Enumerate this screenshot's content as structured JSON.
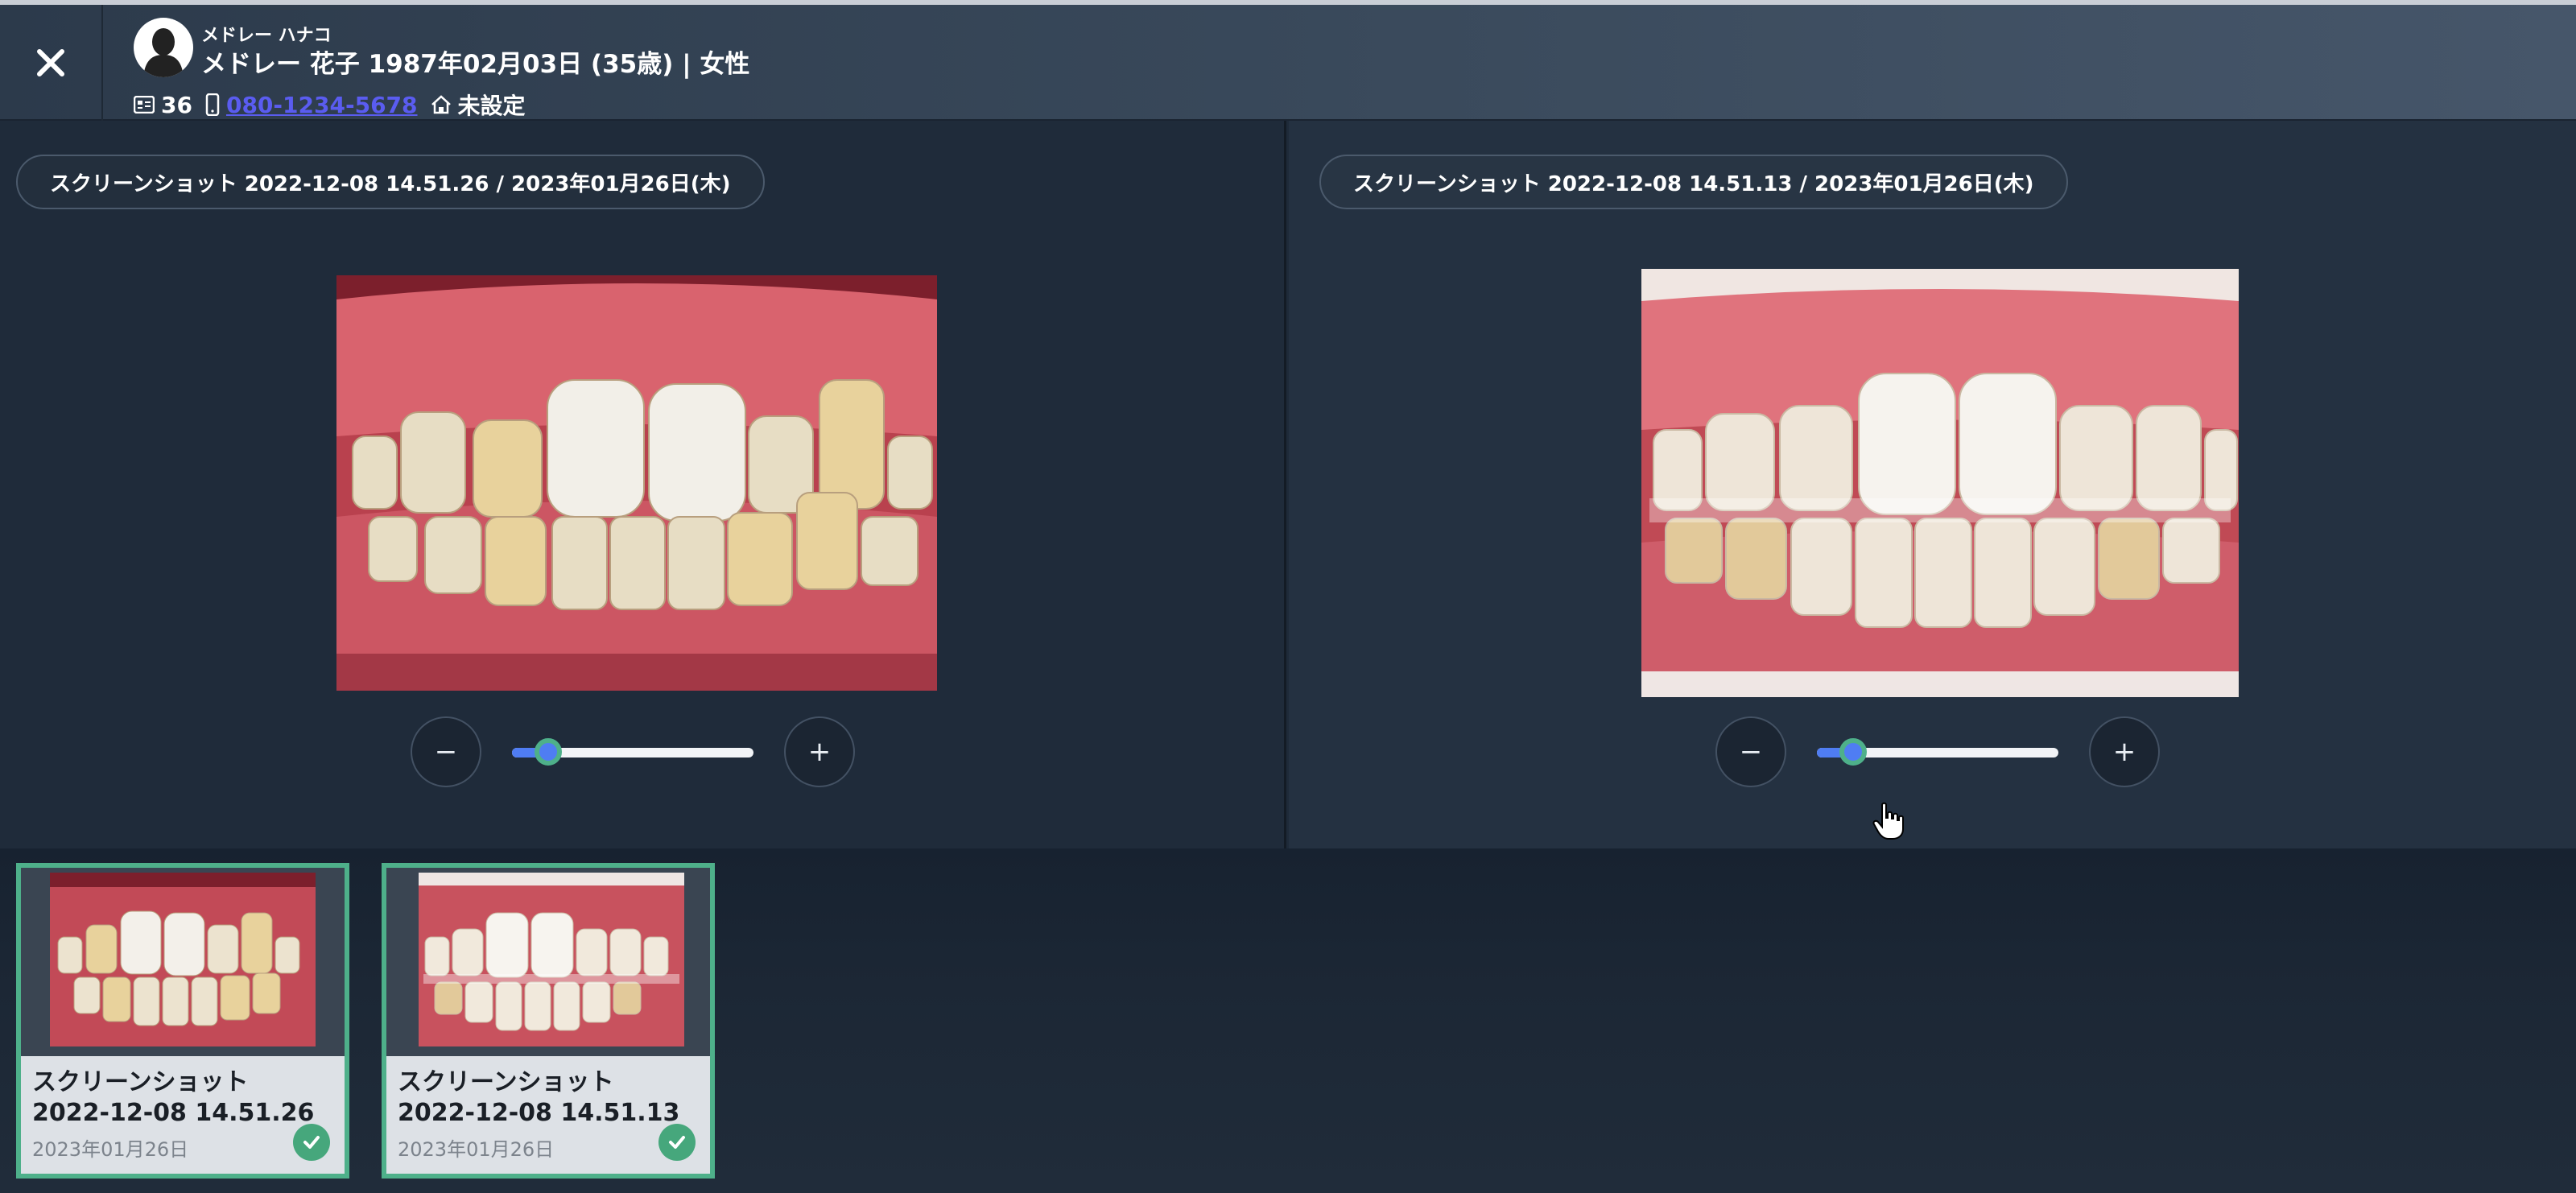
{
  "header": {
    "close_icon": "close-icon",
    "kana_name": "メドレー ハナコ",
    "name_line": "メドレー 花子 1987年02月03日 (35歳) | 女性",
    "patient_id": "36",
    "phone": "080-1234-5678",
    "address": "未設定",
    "phone_color": "#5a5cf0"
  },
  "panels": [
    {
      "title": "スクリーンショット 2022-12-08 14.51.26 / 2023年01月26日(木)",
      "zoom_minus": "−",
      "zoom_plus": "+",
      "zoom_level": 0.15
    },
    {
      "title": "スクリーンショット 2022-12-08 14.51.13 / 2023年01月26日(木)",
      "zoom_minus": "−",
      "zoom_plus": "+",
      "zoom_level": 0.15
    }
  ],
  "thumbnails": [
    {
      "name": "スクリーンショット 2022-12-08 14.51.26",
      "date": "2023年01月26日",
      "selected": true
    },
    {
      "name": "スクリーンショット 2022-12-08 14.51.13",
      "date": "2023年01月26日",
      "selected": true
    }
  ],
  "colors": {
    "accent": "#4f7df3",
    "selected_border": "#4eb08a",
    "check": "#46a77c"
  }
}
